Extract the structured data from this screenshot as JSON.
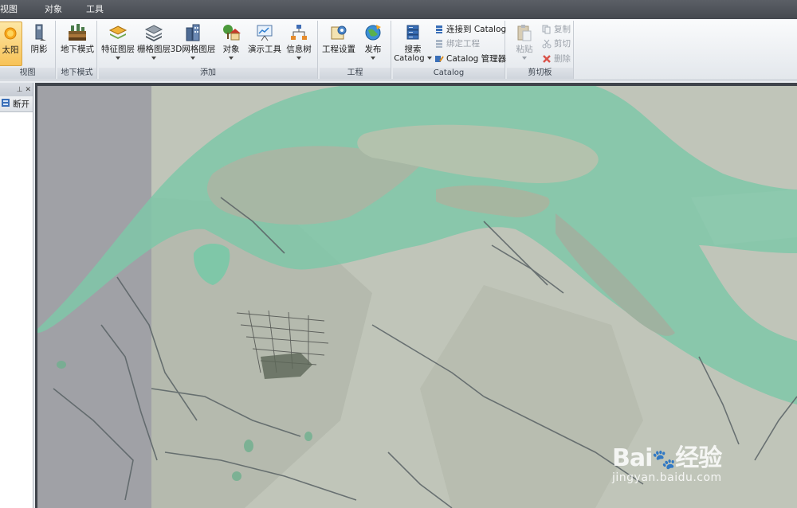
{
  "menu": {
    "items": [
      "视图",
      "对象",
      "工具"
    ]
  },
  "ribbon": {
    "groups": [
      {
        "label": "视图",
        "buttons": [
          {
            "label": "太阳",
            "active": true
          },
          {
            "label": "阴影"
          }
        ]
      },
      {
        "label": "地下模式",
        "buttons": [
          {
            "label": "地下模式"
          }
        ]
      },
      {
        "label": "添加",
        "buttons": [
          {
            "label": "特征图层"
          },
          {
            "label": "栅格图层"
          },
          {
            "label": "3D网格图层"
          },
          {
            "label": "对象"
          },
          {
            "label": "演示工具"
          },
          {
            "label": "信息树"
          }
        ]
      },
      {
        "label": "工程",
        "buttons": [
          {
            "label": "工程设置"
          },
          {
            "label": "发布"
          }
        ]
      },
      {
        "label": "Catalog",
        "buttons": [
          {
            "label": "搜索",
            "sublabel": "Catalog"
          }
        ],
        "small_buttons": [
          {
            "label": "连接到 Catalog"
          },
          {
            "label": "绑定工程",
            "disabled": true
          },
          {
            "label": "Catalog 管理器"
          }
        ]
      },
      {
        "label": "剪切板",
        "buttons": [
          {
            "label": "粘贴",
            "disabled": true
          }
        ],
        "small_buttons": [
          {
            "label": "复制",
            "disabled": true
          },
          {
            "label": "剪切",
            "disabled": true
          },
          {
            "label": "删除",
            "disabled": true
          }
        ]
      }
    ]
  },
  "sidepanel": {
    "pin_icon": "pin-icon",
    "close_icon": "close-icon",
    "tab_label": "断开"
  },
  "watermark": {
    "brand": "Bai",
    "brand_suffix": "经验",
    "url": "jingyan.baidu.com"
  },
  "colors": {
    "water": "#7fc7a8",
    "land": "#b9bfb3",
    "offmap": "#a0a1a6",
    "ribbon_active": "#f7c257"
  }
}
